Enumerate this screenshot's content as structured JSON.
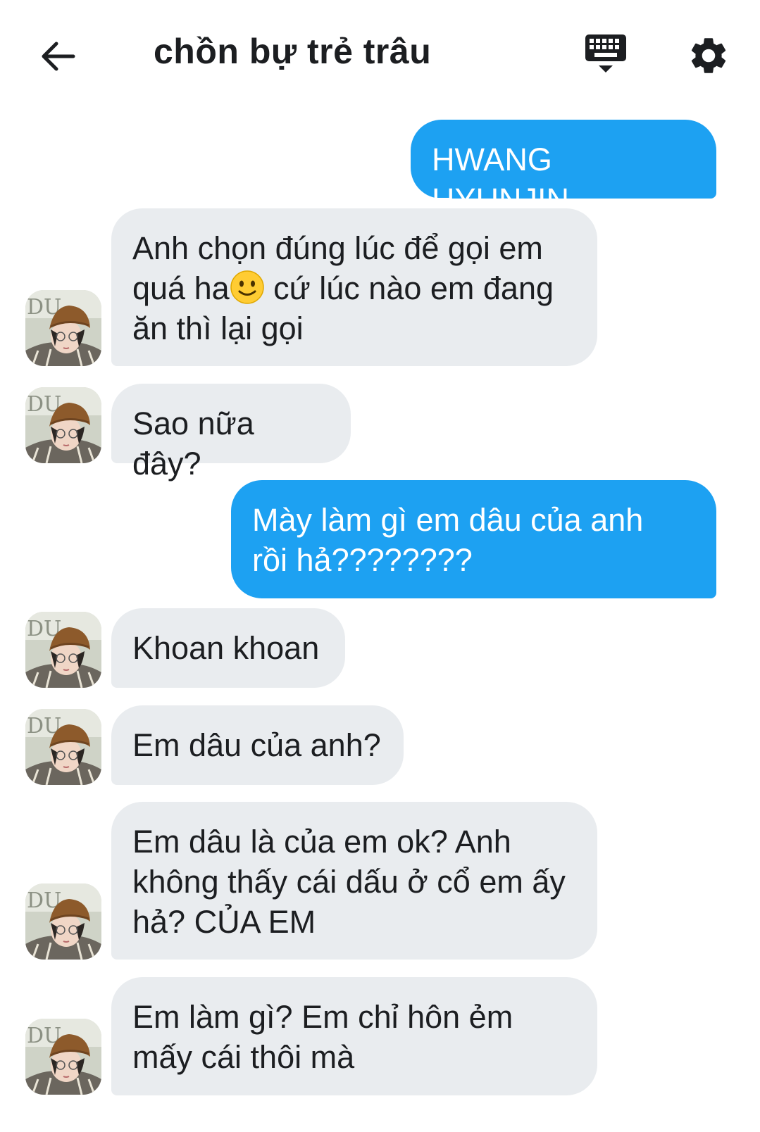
{
  "header": {
    "back_icon": "arrow-left-icon",
    "title": "chồn bự trẻ trâu",
    "keyboard_icon": "keyboard-icon",
    "settings_icon": "gear-icon"
  },
  "colors": {
    "outgoing_bubble": "#1da1f2",
    "incoming_bubble": "#e9ecef",
    "text": "#1c1e21"
  },
  "messages": [
    {
      "direction": "outgoing",
      "text": "HWANG HYUNJIN"
    },
    {
      "direction": "incoming",
      "text_before_emoji": "Anh chọn đúng lúc để gọi em\nquá ha",
      "emoji": "slightly-smiling-face-emoji",
      "text_after_emoji": " cứ lúc nào em đang\năn thì lại gọi"
    },
    {
      "direction": "incoming",
      "text": "Sao nữa đây?"
    },
    {
      "direction": "outgoing",
      "text": "Mày làm gì em dâu của anh\nrồi hả????????"
    },
    {
      "direction": "incoming",
      "text": "Khoan khoan"
    },
    {
      "direction": "incoming",
      "text": "Em dâu của anh?"
    },
    {
      "direction": "incoming",
      "text": "Em dâu là của em ok? Anh\nkhông thấy cái dấu ở cổ em ấy\nhả? CỦA EM"
    },
    {
      "direction": "incoming",
      "text": "Em làm gì? Em chỉ hôn ẻm\nmấy cái thôi mà"
    }
  ]
}
